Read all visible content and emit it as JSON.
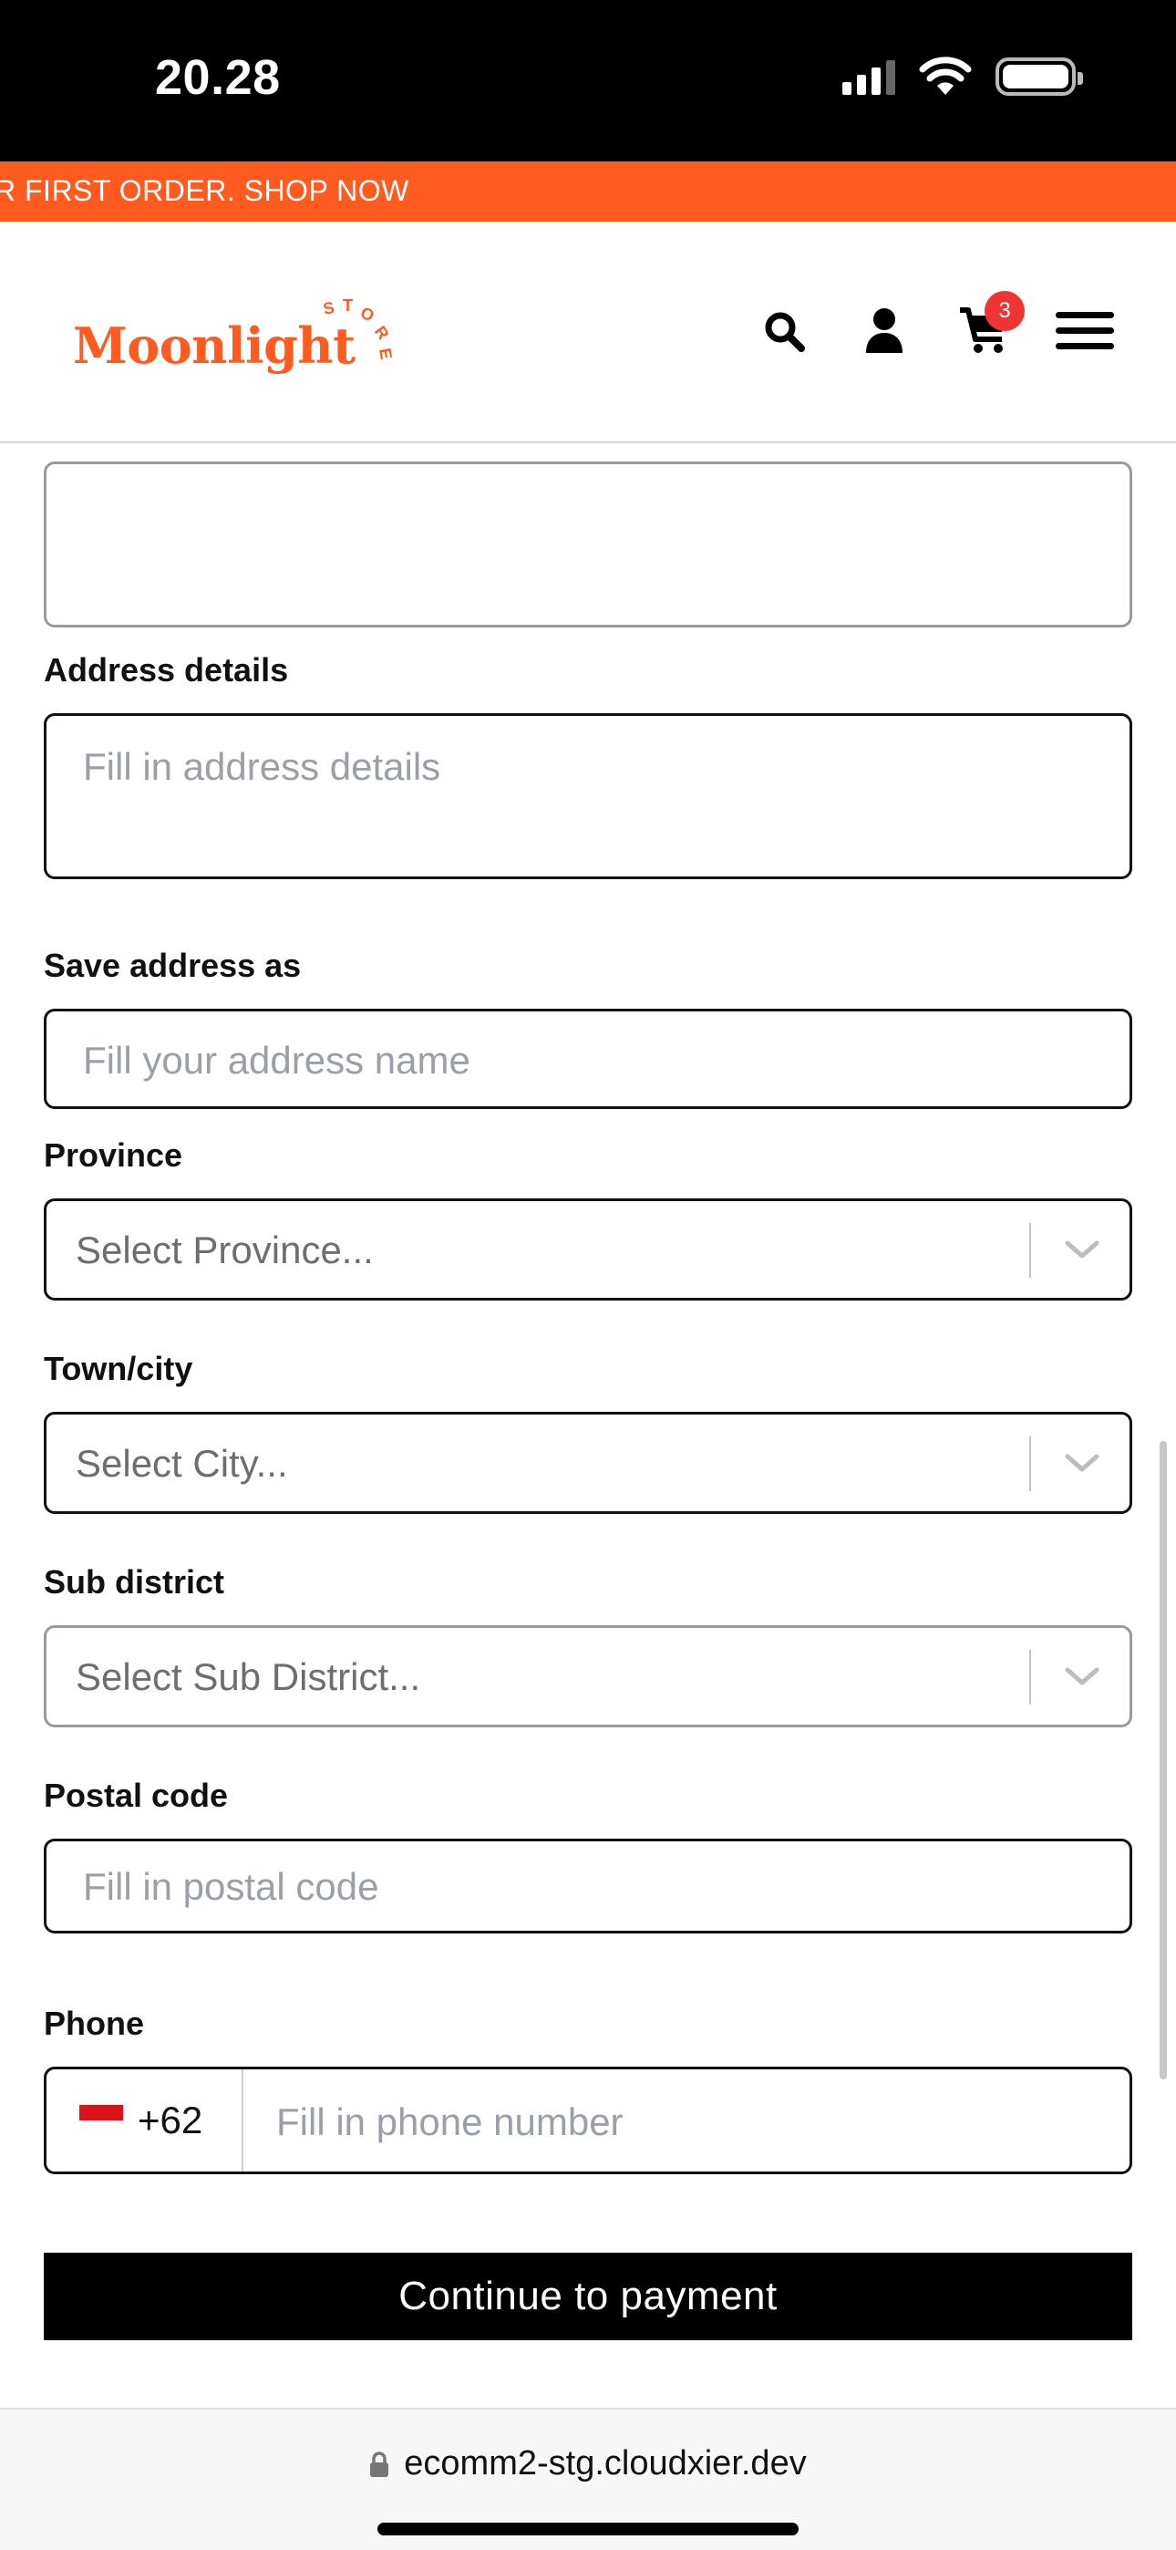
{
  "status_bar": {
    "time": "20.28",
    "icons": [
      "signal-icon",
      "wifi-icon",
      "battery-icon"
    ]
  },
  "promo": {
    "text": "R FIRST ORDER. SHOP NOW"
  },
  "header": {
    "logo_text": "Moonlight",
    "logo_tag": "STORE",
    "cart_count": "3",
    "icons": [
      "search-icon",
      "user-icon",
      "cart-icon",
      "menu-icon"
    ]
  },
  "form": {
    "address_details": {
      "label": "Address details",
      "placeholder": "Fill in address details"
    },
    "save_as": {
      "label": "Save address as",
      "placeholder": "Fill your address name"
    },
    "province": {
      "label": "Province",
      "placeholder": "Select Province..."
    },
    "city": {
      "label": "Town/city",
      "placeholder": "Select City..."
    },
    "sub_district": {
      "label": "Sub district",
      "placeholder": "Select Sub District..."
    },
    "postal_code": {
      "label": "Postal code",
      "placeholder": "Fill in postal code"
    },
    "phone": {
      "label": "Phone",
      "dial_code": "+62",
      "placeholder": "Fill in phone number"
    }
  },
  "continue_button": "Continue to payment",
  "browser": {
    "url": "ecomm2-stg.cloudxier.dev"
  },
  "colors": {
    "brand": "#ff5a1f",
    "badge": "#ef3434",
    "button": "#000000"
  }
}
